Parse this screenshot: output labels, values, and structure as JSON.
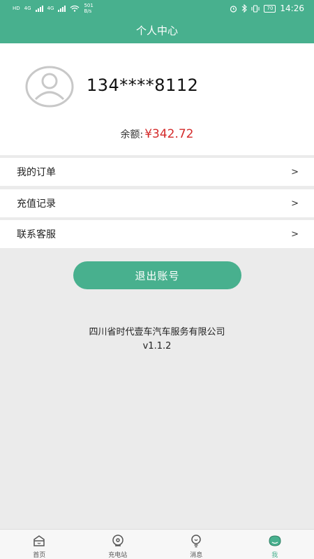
{
  "status_bar": {
    "left_labels": [
      "HD",
      "4G",
      "4G"
    ],
    "net_speed": "501",
    "net_speed_unit": "B/s",
    "battery": "70",
    "time": "14:26"
  },
  "header": {
    "title": "个人中心"
  },
  "profile": {
    "phone": "134****8112",
    "balance_label": "余额:",
    "balance_value": "¥342.72"
  },
  "menu": {
    "items": [
      {
        "label": "我的订单",
        "arrow": ">"
      },
      {
        "label": "充值记录",
        "arrow": ">"
      },
      {
        "label": "联系客服",
        "arrow": ">"
      }
    ]
  },
  "logout_label": "退出账号",
  "footer": {
    "company": "四川省时代壹车汽车服务有限公司",
    "version": "v1.1.2"
  },
  "tabbar": {
    "tabs": [
      {
        "label": "首页",
        "icon": "home-icon"
      },
      {
        "label": "充电站",
        "icon": "location-icon"
      },
      {
        "label": "消息",
        "icon": "bulb-icon"
      },
      {
        "label": "我",
        "icon": "me-icon"
      }
    ],
    "active_color": "#48b08e"
  },
  "colors": {
    "accent": "#48b08e",
    "balance": "#d42b2b"
  }
}
